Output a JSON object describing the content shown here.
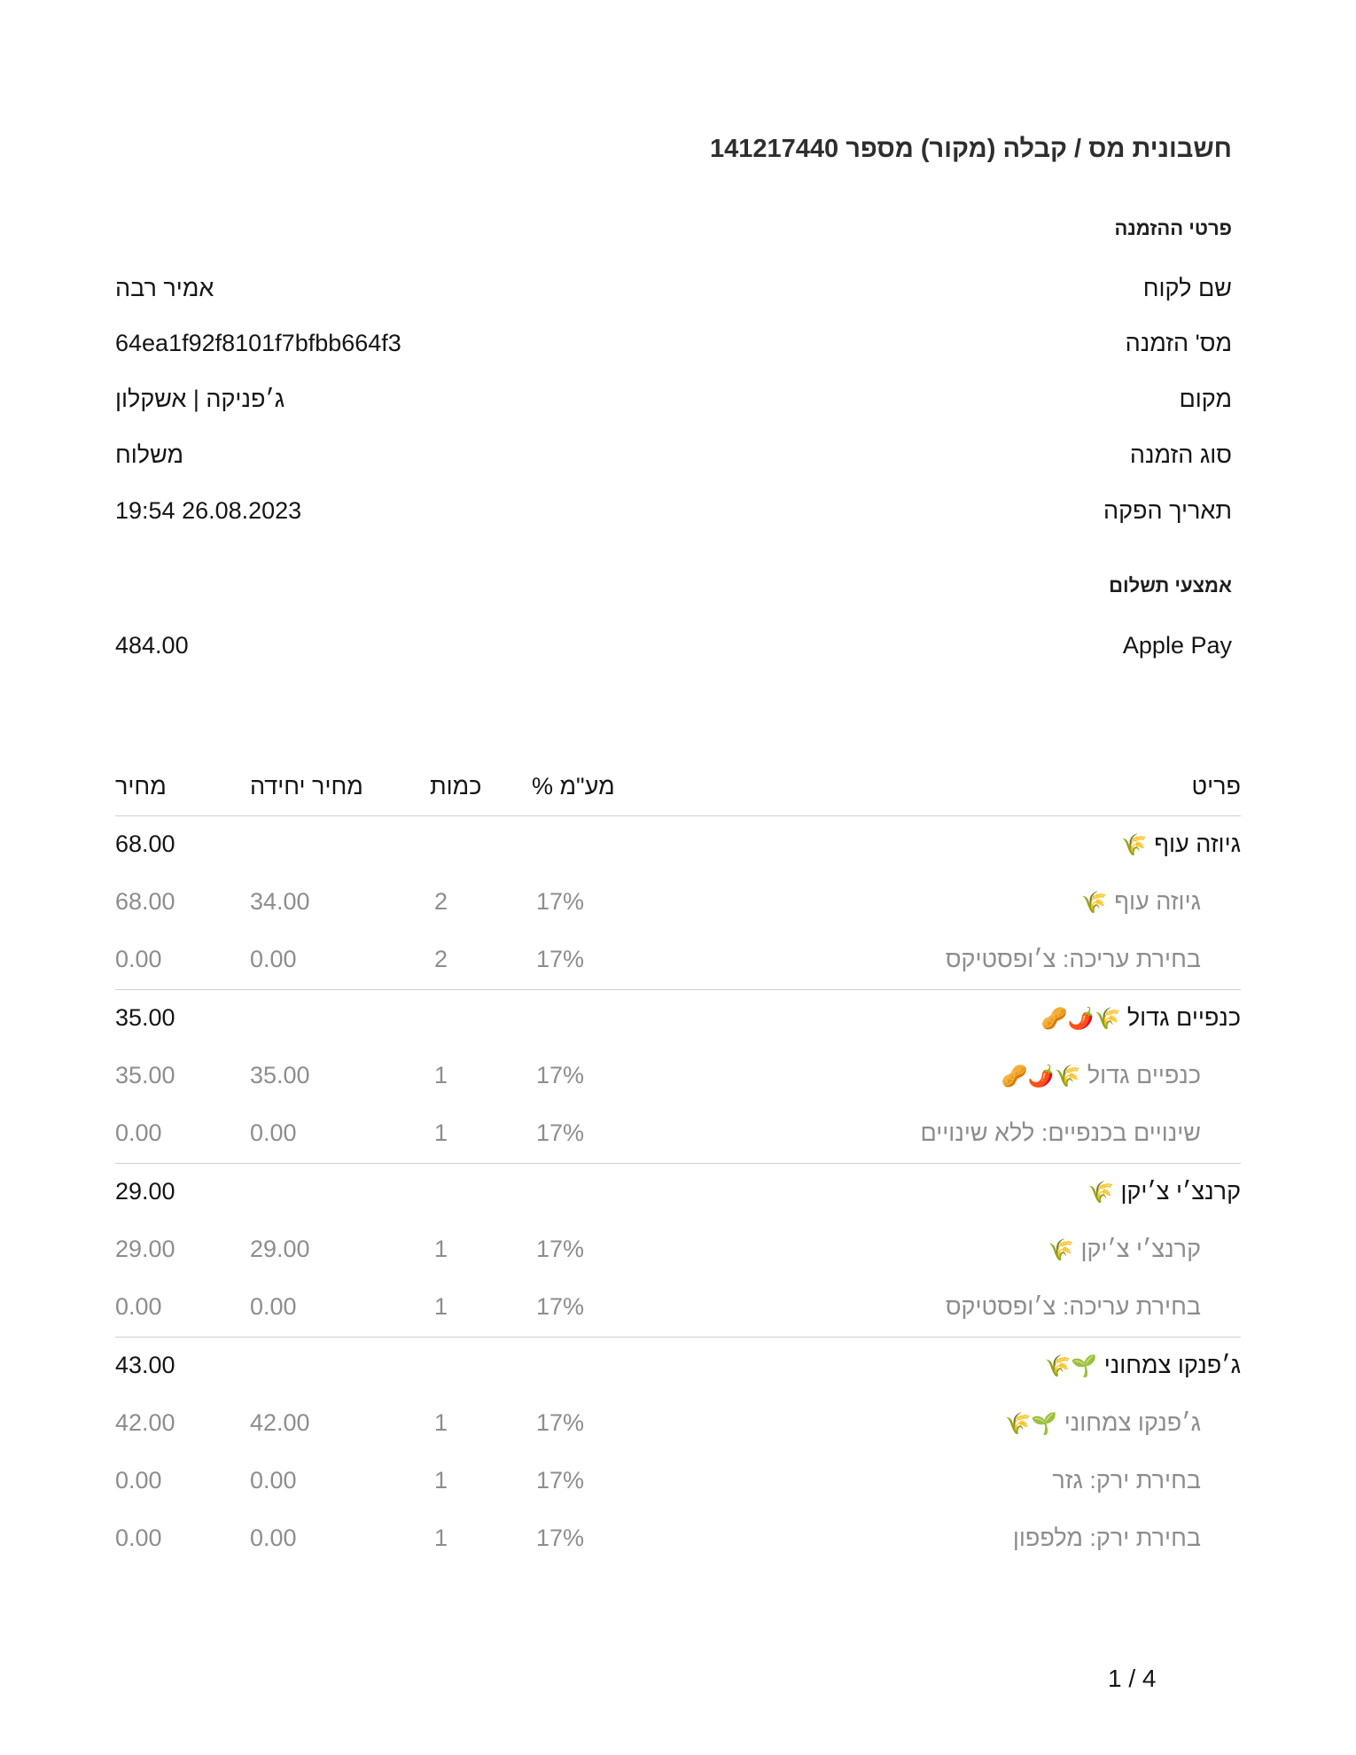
{
  "document": {
    "title": "חשבונית מס / קבלה (מקור) מספר 141217440",
    "order_section_heading": "פרטי ההזמנה",
    "order_details": [
      {
        "label": "שם לקוח",
        "value": "אמיר רבה"
      },
      {
        "label": "מס' הזמנה",
        "value": "64ea1f92f8101f7bfbb664f3"
      },
      {
        "label": "מקום",
        "value": "ג׳פניקה | אשקלון"
      },
      {
        "label": "סוג הזמנה",
        "value": "משלוח"
      },
      {
        "label": "תאריך הפקה",
        "value": "19:54 26.08.2023"
      }
    ],
    "payment_section_heading": "אמצעי תשלום",
    "payment": {
      "label": "Apple Pay",
      "value": "484.00"
    },
    "table_headers": {
      "item": "פריט",
      "vat": "מע\"מ %",
      "qty": "כמות",
      "unit_price": "מחיר יחידה",
      "price": "מחיר"
    },
    "groups": [
      {
        "name": "גיוזה עוף",
        "icons": "🌾",
        "price": "68.00",
        "rows": [
          {
            "name": "גיוזה עוף",
            "icons": "🌾",
            "vat": "17%",
            "qty": "2",
            "unit": "34.00",
            "price": "68.00"
          },
          {
            "name": "בחירת עריכה: צ׳ופסטיקס",
            "icons": "",
            "vat": "17%",
            "qty": "2",
            "unit": "0.00",
            "price": "0.00"
          }
        ]
      },
      {
        "name": "כנפיים גדול",
        "icons": "🌾🌶️🥜",
        "price": "35.00",
        "rows": [
          {
            "name": "כנפיים גדול",
            "icons": "🌾🌶️🥜",
            "vat": "17%",
            "qty": "1",
            "unit": "35.00",
            "price": "35.00"
          },
          {
            "name": "שינויים בכנפיים: ללא שינויים",
            "icons": "",
            "vat": "17%",
            "qty": "1",
            "unit": "0.00",
            "price": "0.00"
          }
        ]
      },
      {
        "name": "קרנצ׳י צ׳יקן",
        "icons": "🌾",
        "price": "29.00",
        "rows": [
          {
            "name": "קרנצ׳י צ׳יקן",
            "icons": "🌾",
            "vat": "17%",
            "qty": "1",
            "unit": "29.00",
            "price": "29.00"
          },
          {
            "name": "בחירת עריכה: צ׳ופסטיקס",
            "icons": "",
            "vat": "17%",
            "qty": "1",
            "unit": "0.00",
            "price": "0.00"
          }
        ]
      },
      {
        "name": "ג׳פנקו צמחוני",
        "icons": "🌱🌾",
        "price": "43.00",
        "rows": [
          {
            "name": "ג׳פנקו צמחוני",
            "icons": "🌱🌾",
            "vat": "17%",
            "qty": "1",
            "unit": "42.00",
            "price": "42.00"
          },
          {
            "name": "בחירת ירק: גזר",
            "icons": "",
            "vat": "17%",
            "qty": "1",
            "unit": "0.00",
            "price": "0.00"
          },
          {
            "name": "בחירת ירק: מלפפון",
            "icons": "",
            "vat": "17%",
            "qty": "1",
            "unit": "0.00",
            "price": "0.00"
          }
        ]
      }
    ],
    "pager": "1 / 4"
  }
}
